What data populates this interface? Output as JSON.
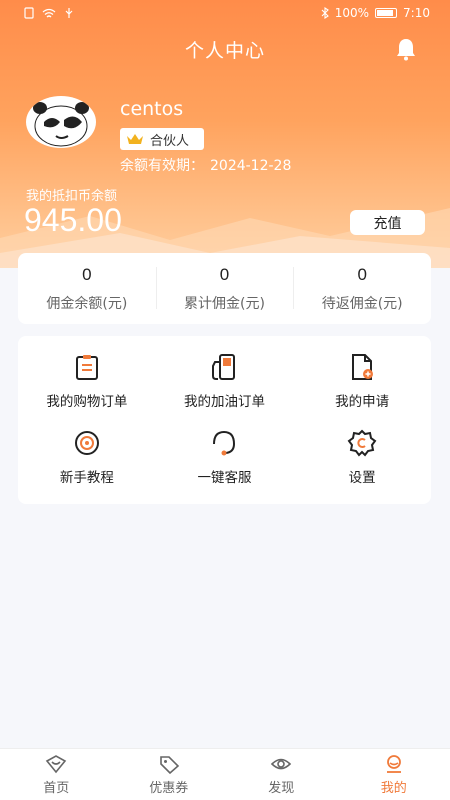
{
  "status_bar": {
    "battery": "100%",
    "time": "7:10"
  },
  "header": {
    "title": "个人中心",
    "notification_icon": "bell-icon"
  },
  "profile": {
    "username": "centos",
    "badge_icon": "crown-icon",
    "badge_label": "合伙人",
    "expiry_label": "余额有效期：",
    "expiry_date": "2024-12-28"
  },
  "balance": {
    "label": "我的抵扣币余额",
    "value": "945.00",
    "recharge_label": "充值"
  },
  "stats": [
    {
      "value": "0",
      "label": "佣金余额(元)"
    },
    {
      "value": "0",
      "label": "累计佣金(元)"
    },
    {
      "value": "0",
      "label": "待返佣金(元)"
    }
  ],
  "menu": [
    {
      "icon": "clipboard-icon",
      "label": "我的购物订单"
    },
    {
      "icon": "fuel-pump-icon",
      "label": "我的加油订单"
    },
    {
      "icon": "document-add-icon",
      "label": "我的申请"
    },
    {
      "icon": "target-icon",
      "label": "新手教程"
    },
    {
      "icon": "headset-icon",
      "label": "一键客服"
    },
    {
      "icon": "gear-icon",
      "label": "设置"
    }
  ],
  "tabs": [
    {
      "icon": "home-icon",
      "label": "首页",
      "active": false
    },
    {
      "icon": "coupon-tag-icon",
      "label": "优惠券",
      "active": false
    },
    {
      "icon": "eye-icon",
      "label": "发现",
      "active": false
    },
    {
      "icon": "profile-icon",
      "label": "我的",
      "active": true
    }
  ],
  "colors": {
    "accent": "#f07a3a",
    "header_gradient_top": "#ff8c4a",
    "header_gradient_bottom": "#ffcfa0",
    "background": "#f6f7fb"
  }
}
